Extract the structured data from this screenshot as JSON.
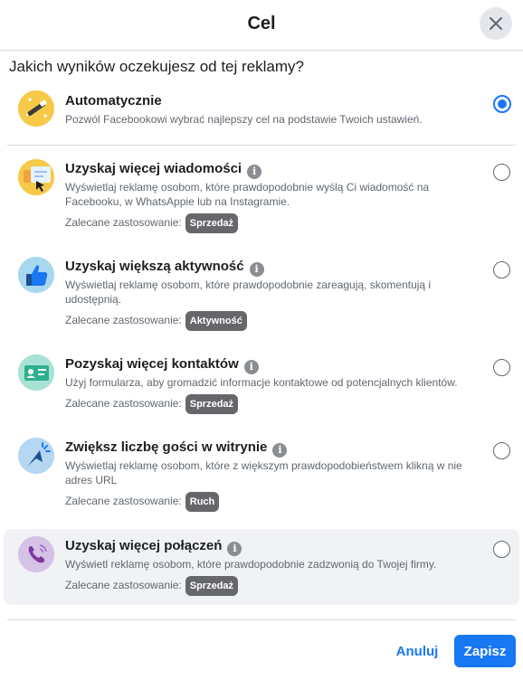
{
  "dialog": {
    "title": "Cel",
    "question": "Jakich wyników oczekujesz od tej reklamy?"
  },
  "icons": {
    "info": "i"
  },
  "options": [
    {
      "title": "Automatycznie",
      "description": "Pozwól Facebookowi wybrać najlepszy cel na podstawie Twoich ustawień.",
      "selected": true,
      "icon": "magic-wand-icon"
    },
    {
      "title": "Uzyskaj więcej wiadomości",
      "description": "Wyświetlaj reklamę osobom, które prawdopodobnie wyślą Ci wiadomość na Facebooku, w WhatsAppie lub na Instagramie.",
      "recommended_label": "Zalecane zastosowanie:",
      "badge": "Sprzedaż",
      "selected": false,
      "icon": "messages-icon"
    },
    {
      "title": "Uzyskaj większą aktywność",
      "description": "Wyświetlaj reklamę osobom, które prawdopodobnie zareagują, skomentują i udostępnią.",
      "recommended_label": "Zalecane zastosowanie:",
      "badge": "Aktywność",
      "selected": false,
      "icon": "thumbs-up-icon"
    },
    {
      "title": "Pozyskaj więcej kontaktów",
      "description": "Użyj formularza, aby gromadzić informacje kontaktowe od potencjalnych klientów.",
      "recommended_label": "Zalecane zastosowanie:",
      "badge": "Sprzedaż",
      "selected": false,
      "icon": "contact-card-icon"
    },
    {
      "title": "Zwiększ liczbę gości w witrynie",
      "description": "Wyświetlaj reklamę osobom, które z większym prawdopodobieństwem klikną w nie adres URL",
      "recommended_label": "Zalecane zastosowanie:",
      "badge": "Ruch",
      "selected": false,
      "icon": "cursor-click-icon"
    },
    {
      "title": "Uzyskaj więcej połączeń",
      "description": "Wyświetl reklamę osobom, które prawdopodobnie zadzwonią do Twojej firmy.",
      "recommended_label": "Zalecane zastosowanie:",
      "badge": "Sprzedaż",
      "selected": false,
      "icon": "phone-icon"
    }
  ],
  "footer": {
    "cancel_label": "Anuluj",
    "save_label": "Zapisz"
  }
}
